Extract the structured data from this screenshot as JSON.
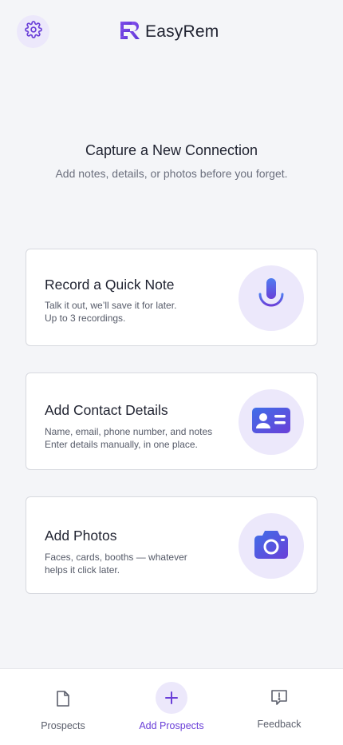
{
  "header": {
    "app_name": "EasyRem",
    "settings_icon": "gear-icon",
    "logo_icon": "er-monogram-logo"
  },
  "hero": {
    "title": "Capture a New Connection",
    "subtitle": "Add notes, details, or photos before you forget."
  },
  "cards": [
    {
      "title": "Record a Quick Note",
      "desc_line1": "Talk it out, we’ll save it for later.",
      "desc_line2": "Up to 3 recordings.",
      "icon": "microphone-icon"
    },
    {
      "title": "Add Contact Details",
      "desc_line1": "Name, email, phone number, and notes",
      "desc_line2": "Enter details manually, in one place.",
      "icon": "contact-card-icon"
    },
    {
      "title": "Add Photos",
      "desc_line1": "Faces, cards, booths — whatever",
      "desc_line2": "helps it click later.",
      "icon": "camera-icon"
    }
  ],
  "bottom_nav": {
    "items": [
      {
        "label": "Prospects",
        "icon": "document-icon",
        "active": false
      },
      {
        "label": "Add Prospects",
        "icon": "plus-icon",
        "active": true
      },
      {
        "label": "Feedback",
        "icon": "feedback-icon",
        "active": false
      }
    ]
  },
  "colors": {
    "accent": "#6a3fd8",
    "accent_soft": "#ece8fb",
    "background": "#f4f5f8",
    "card_border": "#d7d9df"
  }
}
